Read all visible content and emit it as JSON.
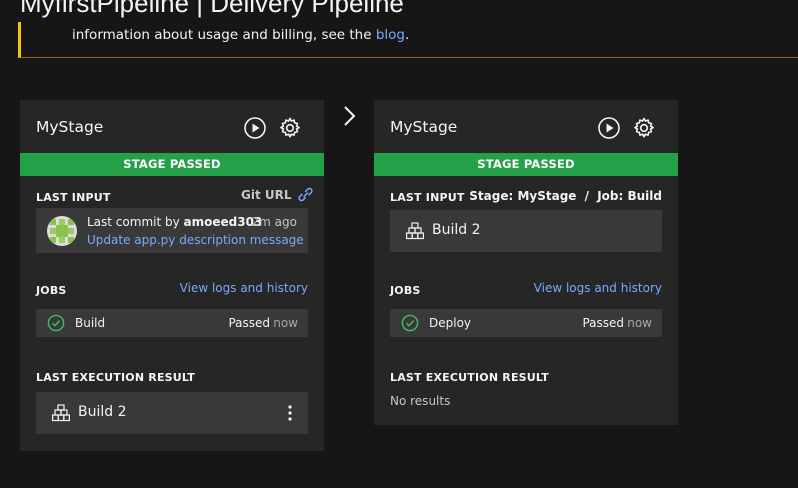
{
  "header": {
    "title": "MyfirstPipeline | Delivery Pipeline"
  },
  "notice": {
    "text_before": "information about usage and billing, see the ",
    "link": "blog",
    "text_after": "."
  },
  "colors": {
    "background": "#161616",
    "card": "#262626",
    "tile": "#393939",
    "success": "#24a148",
    "link": "#78a9ff",
    "warning": "#f1c21b"
  },
  "stages": [
    {
      "name": "MyStage",
      "status": "STAGE PASSED",
      "last_input": {
        "label": "LAST INPUT",
        "link": "Git URL",
        "commit_prefix": "Last commit by ",
        "author": "amoeed303",
        "time": "2m ago",
        "message": "Update app.py description message"
      },
      "jobs": {
        "label": "JOBS",
        "link": "View logs and history",
        "items": [
          {
            "name": "Build",
            "status": "Passed",
            "time": "now"
          }
        ]
      },
      "last_result": {
        "label": "LAST EXECUTION RESULT",
        "value": "Build 2"
      }
    },
    {
      "name": "MyStage",
      "status": "STAGE PASSED",
      "last_input": {
        "label": "LAST INPUT",
        "stage_prefix": "Stage:",
        "stage_name": "MyStage",
        "separator": "/",
        "job_prefix": "Job:",
        "job_name": "Build",
        "value": "Build 2"
      },
      "jobs": {
        "label": "JOBS",
        "link": "View logs and history",
        "items": [
          {
            "name": "Deploy",
            "status": "Passed",
            "time": "now"
          }
        ]
      },
      "last_result": {
        "label": "LAST EXECUTION RESULT",
        "value": "No results"
      }
    }
  ]
}
